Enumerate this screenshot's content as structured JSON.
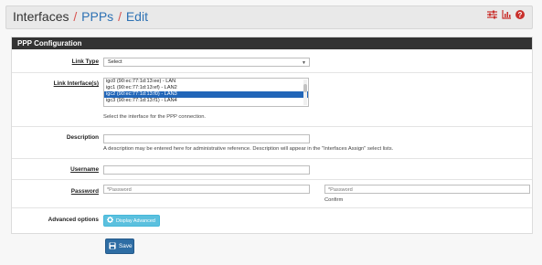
{
  "breadcrumb": {
    "first": "Interfaces",
    "separator": "/",
    "second": "PPPs",
    "third": "Edit"
  },
  "header_icons": [
    "sliders-icon",
    "chart-icon",
    "help-icon"
  ],
  "panel": {
    "title": "PPP Configuration"
  },
  "link_type": {
    "label": "Link Type",
    "value": "Select"
  },
  "link_interfaces": {
    "label": "Link Interface(s)",
    "options": [
      "igc0 (90:ec:77:1d:13:ee) - LAN",
      "igc1 (90:ec:77:1d:13:ef) - LAN2",
      "igc2 (90:ec:77:1d:13:f0) - LAN3",
      "igc3 (90:ec:77:1d:13:f1) - LAN4"
    ],
    "selected_index": 2,
    "help": "Select the interface for the PPP connection."
  },
  "description": {
    "label": "Description",
    "value": "",
    "help": "A description may be entered here for administrative reference. Description will appear in the \"Interfaces Assign\" select lists."
  },
  "username": {
    "label": "Username",
    "value": ""
  },
  "password": {
    "label": "Password",
    "placeholder": "*Password",
    "confirm_placeholder": "*Password",
    "confirm_label": "Confirm"
  },
  "advanced": {
    "label": "Advanced options",
    "button": "Display Advanced"
  },
  "save_button": "Save",
  "colors": {
    "link_blue": "#2e72b4",
    "separator_red": "#d9534f",
    "panel_header": "#333333",
    "info_button": "#5bc0de",
    "primary_button": "#2e6da4"
  }
}
